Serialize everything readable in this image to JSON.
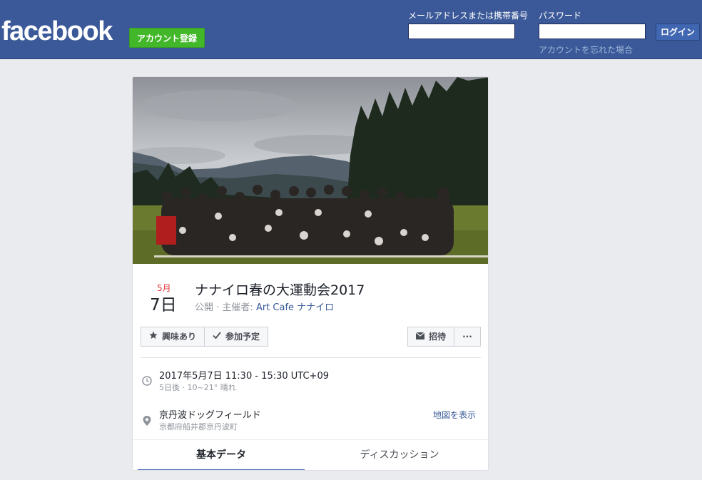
{
  "header": {
    "logo": "facebook",
    "signup_label": "アカウント登録",
    "email_label": "メールアドレスまたは携帯番号",
    "password_label": "パスワード",
    "email_value": "",
    "password_value": "",
    "login_label": "ログイン",
    "forgot_label": "アカウントを忘れた場合"
  },
  "event": {
    "month": "5月",
    "day": "7日",
    "title": "ナナイロ春の大運動会2017",
    "privacy": "公開",
    "host_prefix": "主催者:",
    "host_name": "Art Cafe ナナイロ",
    "actions": {
      "interested": "興味あり",
      "going": "参加予定",
      "invite": "招待",
      "more": "···"
    },
    "time_main": "2017年5月7日 11:30 - 15:30 UTC+09",
    "time_sub": "5日後 · 10~21° 晴れ",
    "place_name": "京丹波ドッグフィールド",
    "place_address": "京都府船井郡京丹波町",
    "map_link": "地図を表示",
    "tabs": [
      "基本データ",
      "ディスカッション"
    ]
  },
  "colors": {
    "brand_blue": "#3b5998",
    "signup_green": "#42b72a",
    "link_blue": "#365899",
    "date_red": "#e0393e"
  }
}
